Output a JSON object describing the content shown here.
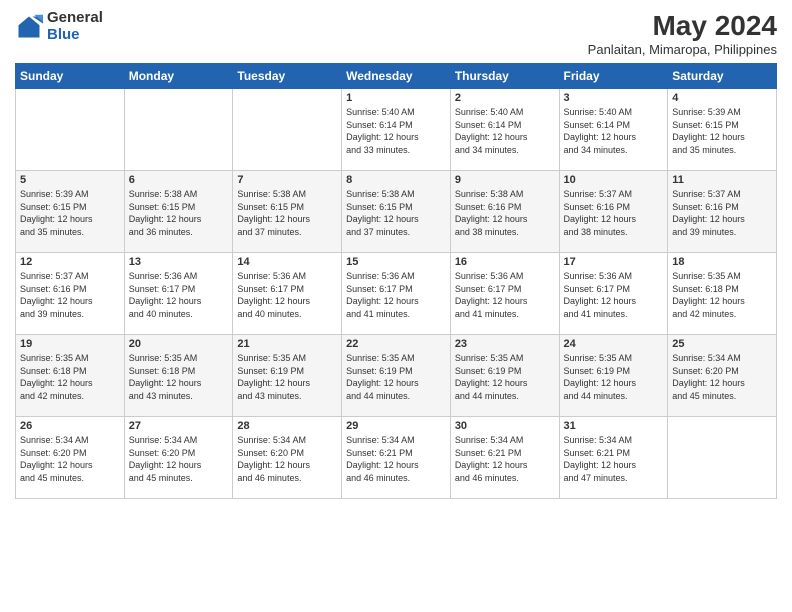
{
  "logo": {
    "general": "General",
    "blue": "Blue"
  },
  "header": {
    "month": "May 2024",
    "location": "Panlaitan, Mimaropa, Philippines"
  },
  "weekdays": [
    "Sunday",
    "Monday",
    "Tuesday",
    "Wednesday",
    "Thursday",
    "Friday",
    "Saturday"
  ],
  "weeks": [
    [
      {
        "day": "",
        "info": ""
      },
      {
        "day": "",
        "info": ""
      },
      {
        "day": "",
        "info": ""
      },
      {
        "day": "1",
        "info": "Sunrise: 5:40 AM\nSunset: 6:14 PM\nDaylight: 12 hours\nand 33 minutes."
      },
      {
        "day": "2",
        "info": "Sunrise: 5:40 AM\nSunset: 6:14 PM\nDaylight: 12 hours\nand 34 minutes."
      },
      {
        "day": "3",
        "info": "Sunrise: 5:40 AM\nSunset: 6:14 PM\nDaylight: 12 hours\nand 34 minutes."
      },
      {
        "day": "4",
        "info": "Sunrise: 5:39 AM\nSunset: 6:15 PM\nDaylight: 12 hours\nand 35 minutes."
      }
    ],
    [
      {
        "day": "5",
        "info": "Sunrise: 5:39 AM\nSunset: 6:15 PM\nDaylight: 12 hours\nand 35 minutes."
      },
      {
        "day": "6",
        "info": "Sunrise: 5:38 AM\nSunset: 6:15 PM\nDaylight: 12 hours\nand 36 minutes."
      },
      {
        "day": "7",
        "info": "Sunrise: 5:38 AM\nSunset: 6:15 PM\nDaylight: 12 hours\nand 37 minutes."
      },
      {
        "day": "8",
        "info": "Sunrise: 5:38 AM\nSunset: 6:15 PM\nDaylight: 12 hours\nand 37 minutes."
      },
      {
        "day": "9",
        "info": "Sunrise: 5:38 AM\nSunset: 6:16 PM\nDaylight: 12 hours\nand 38 minutes."
      },
      {
        "day": "10",
        "info": "Sunrise: 5:37 AM\nSunset: 6:16 PM\nDaylight: 12 hours\nand 38 minutes."
      },
      {
        "day": "11",
        "info": "Sunrise: 5:37 AM\nSunset: 6:16 PM\nDaylight: 12 hours\nand 39 minutes."
      }
    ],
    [
      {
        "day": "12",
        "info": "Sunrise: 5:37 AM\nSunset: 6:16 PM\nDaylight: 12 hours\nand 39 minutes."
      },
      {
        "day": "13",
        "info": "Sunrise: 5:36 AM\nSunset: 6:17 PM\nDaylight: 12 hours\nand 40 minutes."
      },
      {
        "day": "14",
        "info": "Sunrise: 5:36 AM\nSunset: 6:17 PM\nDaylight: 12 hours\nand 40 minutes."
      },
      {
        "day": "15",
        "info": "Sunrise: 5:36 AM\nSunset: 6:17 PM\nDaylight: 12 hours\nand 41 minutes."
      },
      {
        "day": "16",
        "info": "Sunrise: 5:36 AM\nSunset: 6:17 PM\nDaylight: 12 hours\nand 41 minutes."
      },
      {
        "day": "17",
        "info": "Sunrise: 5:36 AM\nSunset: 6:17 PM\nDaylight: 12 hours\nand 41 minutes."
      },
      {
        "day": "18",
        "info": "Sunrise: 5:35 AM\nSunset: 6:18 PM\nDaylight: 12 hours\nand 42 minutes."
      }
    ],
    [
      {
        "day": "19",
        "info": "Sunrise: 5:35 AM\nSunset: 6:18 PM\nDaylight: 12 hours\nand 42 minutes."
      },
      {
        "day": "20",
        "info": "Sunrise: 5:35 AM\nSunset: 6:18 PM\nDaylight: 12 hours\nand 43 minutes."
      },
      {
        "day": "21",
        "info": "Sunrise: 5:35 AM\nSunset: 6:19 PM\nDaylight: 12 hours\nand 43 minutes."
      },
      {
        "day": "22",
        "info": "Sunrise: 5:35 AM\nSunset: 6:19 PM\nDaylight: 12 hours\nand 44 minutes."
      },
      {
        "day": "23",
        "info": "Sunrise: 5:35 AM\nSunset: 6:19 PM\nDaylight: 12 hours\nand 44 minutes."
      },
      {
        "day": "24",
        "info": "Sunrise: 5:35 AM\nSunset: 6:19 PM\nDaylight: 12 hours\nand 44 minutes."
      },
      {
        "day": "25",
        "info": "Sunrise: 5:34 AM\nSunset: 6:20 PM\nDaylight: 12 hours\nand 45 minutes."
      }
    ],
    [
      {
        "day": "26",
        "info": "Sunrise: 5:34 AM\nSunset: 6:20 PM\nDaylight: 12 hours\nand 45 minutes."
      },
      {
        "day": "27",
        "info": "Sunrise: 5:34 AM\nSunset: 6:20 PM\nDaylight: 12 hours\nand 45 minutes."
      },
      {
        "day": "28",
        "info": "Sunrise: 5:34 AM\nSunset: 6:20 PM\nDaylight: 12 hours\nand 46 minutes."
      },
      {
        "day": "29",
        "info": "Sunrise: 5:34 AM\nSunset: 6:21 PM\nDaylight: 12 hours\nand 46 minutes."
      },
      {
        "day": "30",
        "info": "Sunrise: 5:34 AM\nSunset: 6:21 PM\nDaylight: 12 hours\nand 46 minutes."
      },
      {
        "day": "31",
        "info": "Sunrise: 5:34 AM\nSunset: 6:21 PM\nDaylight: 12 hours\nand 47 minutes."
      },
      {
        "day": "",
        "info": ""
      }
    ]
  ]
}
